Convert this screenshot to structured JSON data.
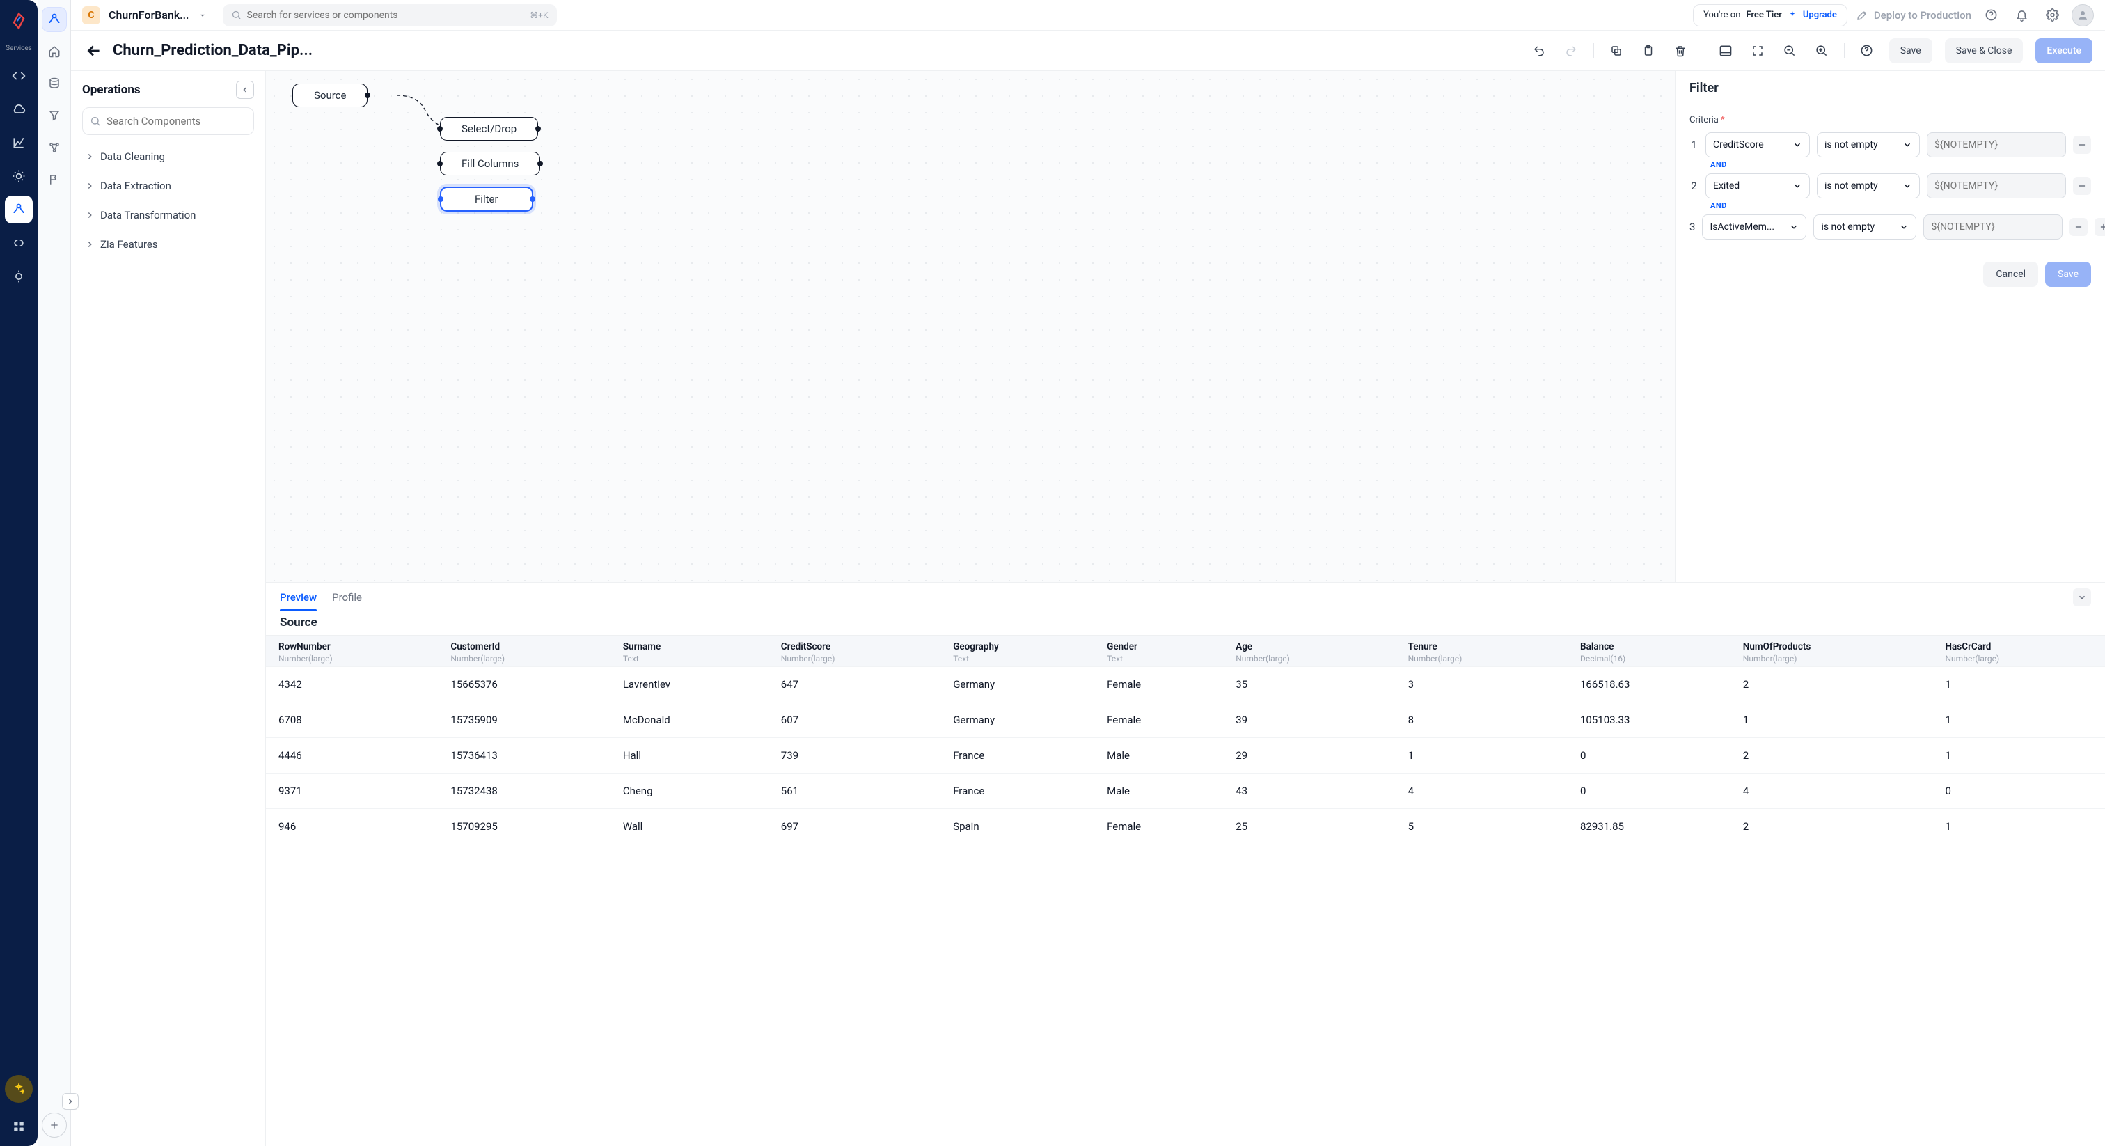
{
  "project": {
    "badge_letter": "C",
    "name": "ChurnForBank..."
  },
  "top": {
    "search_placeholder": "Search for services or components",
    "search_hotkey": "⌘+K",
    "tier_prefix": "You're on ",
    "tier_name": "Free Tier",
    "upgrade_label": "Upgrade",
    "deploy_label": "Deploy to Production"
  },
  "outer_rail": {
    "services_label": "Services"
  },
  "toolbar": {
    "title": "Churn_Prediction_Data_Pip...",
    "save": "Save",
    "save_close": "Save & Close",
    "execute": "Execute"
  },
  "operations": {
    "title": "Operations",
    "search_placeholder": "Search Components",
    "categories": [
      "Data Cleaning",
      "Data Extraction",
      "Data Transformation",
      "Zia Features"
    ]
  },
  "canvas": {
    "nodes": {
      "source": "Source",
      "select_drop": "Select/Drop",
      "fill_columns": "Fill Columns",
      "filter": "Filter"
    }
  },
  "right_panel": {
    "title": "Filter",
    "criteria_label": "Criteria",
    "and_label": "AND",
    "rows": [
      {
        "idx": "1",
        "column": "CreditScore",
        "op": "is not empty",
        "value_placeholder": "${NOTEMPTY}"
      },
      {
        "idx": "2",
        "column": "Exited",
        "op": "is not empty",
        "value_placeholder": "${NOTEMPTY}"
      },
      {
        "idx": "3",
        "column": "IsActiveMem...",
        "op": "is not empty",
        "value_placeholder": "${NOTEMPTY}"
      }
    ],
    "cancel": "Cancel",
    "save": "Save"
  },
  "preview": {
    "tabs": [
      "Preview",
      "Profile"
    ],
    "active_tab": "Preview",
    "title": "Source",
    "columns": [
      {
        "name": "RowNumber",
        "type": "Number(large)"
      },
      {
        "name": "CustomerId",
        "type": "Number(large)"
      },
      {
        "name": "Surname",
        "type": "Text"
      },
      {
        "name": "CreditScore",
        "type": "Number(large)"
      },
      {
        "name": "Geography",
        "type": "Text"
      },
      {
        "name": "Gender",
        "type": "Text"
      },
      {
        "name": "Age",
        "type": "Number(large)"
      },
      {
        "name": "Tenure",
        "type": "Number(large)"
      },
      {
        "name": "Balance",
        "type": "Decimal(16)"
      },
      {
        "name": "NumOfProducts",
        "type": "Number(large)"
      },
      {
        "name": "HasCrCard",
        "type": "Number(large)"
      }
    ],
    "rows": [
      [
        "4342",
        "15665376",
        "Lavrentiev",
        "647",
        "Germany",
        "Female",
        "35",
        "3",
        "166518.63",
        "2",
        "1"
      ],
      [
        "6708",
        "15735909",
        "McDonald",
        "607",
        "Germany",
        "Female",
        "39",
        "8",
        "105103.33",
        "1",
        "1"
      ],
      [
        "4446",
        "15736413",
        "Hall",
        "739",
        "France",
        "Male",
        "29",
        "1",
        "0",
        "2",
        "1"
      ],
      [
        "9371",
        "15732438",
        "Cheng",
        "561",
        "France",
        "Male",
        "43",
        "4",
        "0",
        "4",
        "0"
      ],
      [
        "946",
        "15709295",
        "Wall",
        "697",
        "Spain",
        "Female",
        "25",
        "5",
        "82931.85",
        "2",
        "1"
      ]
    ]
  }
}
